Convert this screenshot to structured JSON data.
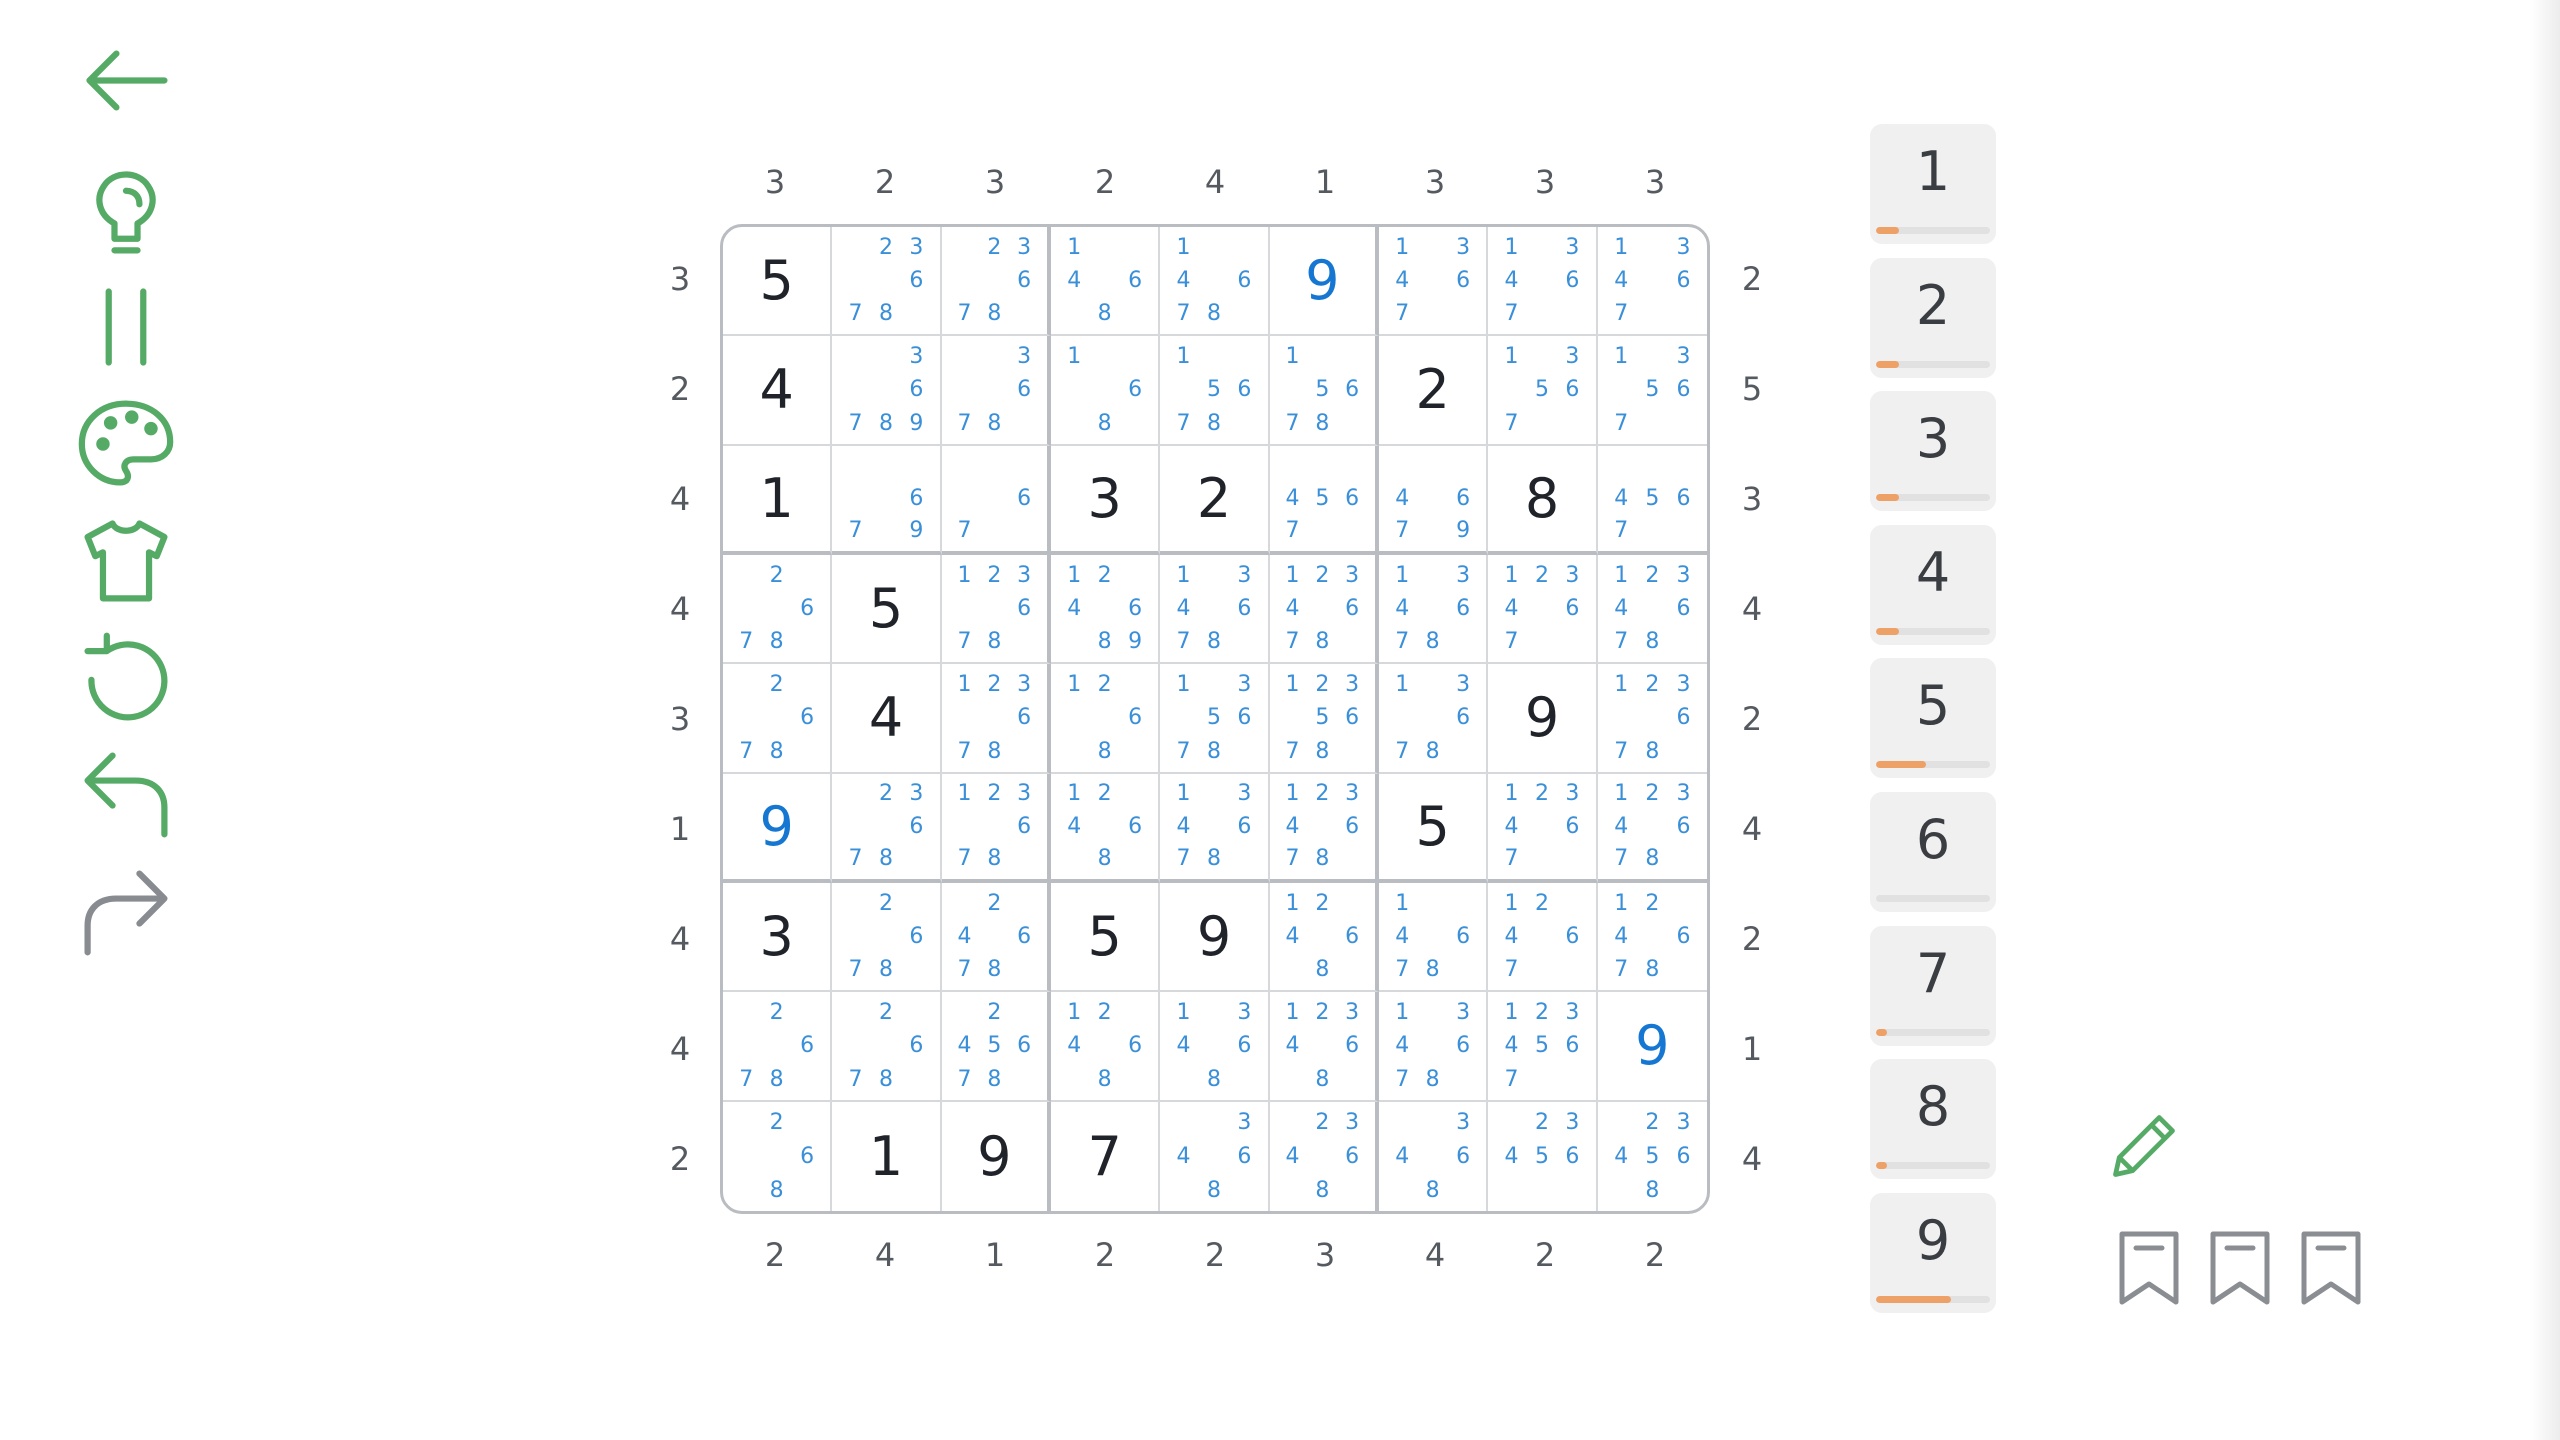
{
  "colors": {
    "toolbar_icon": "#55aa66",
    "redo_disabled": "#888c90",
    "given_digit": "#20242a",
    "entered_digit": "#1677d2",
    "candidate_note": "#3a8fd9",
    "progress_fill": "#eea167",
    "pad_background": "#f0f0f0"
  },
  "toolbar": [
    {
      "name": "back-button",
      "icon": "arrow-left-icon",
      "disabled": false
    },
    {
      "name": "hint-button",
      "icon": "lightbulb-icon",
      "disabled": false
    },
    {
      "name": "pause-button",
      "icon": "pause-icon",
      "disabled": false
    },
    {
      "name": "theme-button",
      "icon": "palette-icon",
      "disabled": false
    },
    {
      "name": "skin-button",
      "icon": "tshirt-icon",
      "disabled": false
    },
    {
      "name": "restart-button",
      "icon": "restart-icon",
      "disabled": false
    },
    {
      "name": "undo-button",
      "icon": "undo-icon",
      "disabled": false
    },
    {
      "name": "redo-button",
      "icon": "redo-icon",
      "disabled": true
    }
  ],
  "clues": {
    "top": [
      "3",
      "2",
      "3",
      "2",
      "4",
      "1",
      "3",
      "3",
      "3"
    ],
    "bottom": [
      "2",
      "4",
      "1",
      "2",
      "2",
      "3",
      "4",
      "2",
      "2"
    ],
    "left": [
      "3",
      "2",
      "4",
      "4",
      "3",
      "1",
      "4",
      "4",
      "2"
    ],
    "right": [
      "2",
      "5",
      "3",
      "4",
      "2",
      "4",
      "2",
      "1",
      "4"
    ]
  },
  "grid": [
    [
      {
        "v": "5",
        "t": "given"
      },
      {
        "n": "23  678"
      },
      {
        "n": "23  678"
      },
      {
        "n": "1 4  6 8"
      },
      {
        "n": "1 4  678"
      },
      {
        "v": "9",
        "t": "entered"
      },
      {
        "n": "1  34 67"
      },
      {
        "n": "1  34 67"
      },
      {
        "n": "1  34 67"
      }
    ],
    [
      {
        "v": "4",
        "t": "given"
      },
      {
        "n": "3  6789"
      },
      {
        "n": "3  678"
      },
      {
        "n": "1  6 8"
      },
      {
        "n": "1  56 78"
      },
      {
        "n": "1  56 78"
      },
      {
        "v": "2",
        "t": "given"
      },
      {
        "n": "1  356 7"
      },
      {
        "n": "1  356 7"
      }
    ],
    [
      {
        "v": "1",
        "t": "given"
      },
      {
        "n": "6 79"
      },
      {
        "n": "6 7"
      },
      {
        "v": "3",
        "t": "given"
      },
      {
        "v": "2",
        "t": "given"
      },
      {
        "n": "456 7"
      },
      {
        "n": "46 79"
      },
      {
        "v": "8",
        "t": "given"
      },
      {
        "n": "456 7"
      }
    ],
    [
      {
        "n": "2  6 78"
      },
      {
        "v": "5",
        "t": "given"
      },
      {
        "n": "123  6 78"
      },
      {
        "n": "12 4  6 89"
      },
      {
        "n": "1  34 6 78"
      },
      {
        "n": "123 4  6 78"
      },
      {
        "n": "1  34 6 78"
      },
      {
        "n": "123 4  6 7"
      },
      {
        "n": "123 4  6 78"
      }
    ],
    [
      {
        "n": "2  6 78"
      },
      {
        "v": "4",
        "t": "given"
      },
      {
        "n": "123  6 78"
      },
      {
        "n": "12  6 8"
      },
      {
        "n": "1  356 78"
      },
      {
        "n": "123  56 78"
      },
      {
        "n": "1  36 78"
      },
      {
        "v": "9",
        "t": "given"
      },
      {
        "n": "123  6 78"
      }
    ],
    [
      {
        "v": "9",
        "t": "entered"
      },
      {
        "n": "23  678"
      },
      {
        "n": "123  678"
      },
      {
        "n": "12 4  6 8"
      },
      {
        "n": "1  34 6 78"
      },
      {
        "n": "123 4  6 78"
      },
      {
        "v": "5",
        "t": "given"
      },
      {
        "n": "123 4  6 7"
      },
      {
        "n": "123 4  6 78"
      }
    ],
    [
      {
        "v": "3",
        "t": "given"
      },
      {
        "n": "2  6 78"
      },
      {
        "n": "2 46 78"
      },
      {
        "v": "5",
        "t": "given"
      },
      {
        "v": "9",
        "t": "given"
      },
      {
        "n": "12 4  6 8"
      },
      {
        "n": "1 46 78"
      },
      {
        "n": "12 4  6 7"
      },
      {
        "n": "12 4  6 78"
      }
    ],
    [
      {
        "n": "2  6 78"
      },
      {
        "n": "2  6 78"
      },
      {
        "n": "2 456 78"
      },
      {
        "n": "12 4  6 8"
      },
      {
        "n": "1  34 6 8"
      },
      {
        "n": "123 4  6 8"
      },
      {
        "n": "1  34 6 78"
      },
      {
        "n": "123 456 7"
      },
      {
        "v": "9",
        "t": "entered"
      }
    ],
    [
      {
        "n": "2  6 8"
      },
      {
        "v": "1",
        "t": "given"
      },
      {
        "v": "9",
        "t": "given"
      },
      {
        "v": "7",
        "t": "given"
      },
      {
        "n": "3 46 8"
      },
      {
        "n": "23 46 8"
      },
      {
        "n": "3 46 8"
      },
      {
        "n": "23 456"
      },
      {
        "n": "23 456 8"
      }
    ]
  ],
  "number_pad": [
    {
      "digit": "1",
      "progress": 0.2
    },
    {
      "digit": "2",
      "progress": 0.2
    },
    {
      "digit": "3",
      "progress": 0.2
    },
    {
      "digit": "4",
      "progress": 0.2
    },
    {
      "digit": "5",
      "progress": 0.44
    },
    {
      "digit": "6",
      "progress": 0
    },
    {
      "digit": "7",
      "progress": 0.1
    },
    {
      "digit": "8",
      "progress": 0.1
    },
    {
      "digit": "9",
      "progress": 0.66
    }
  ],
  "notes_mode": {
    "icon": "pencil-icon"
  },
  "bookmarks": [
    {
      "name": "bookmark-1",
      "icon": "bookmark-icon"
    },
    {
      "name": "bookmark-2",
      "icon": "bookmark-icon"
    },
    {
      "name": "bookmark-3",
      "icon": "bookmark-icon"
    }
  ]
}
